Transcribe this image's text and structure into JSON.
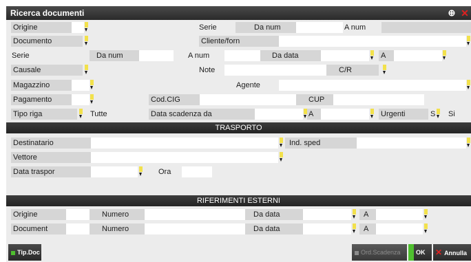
{
  "window": {
    "title": "Ricerca documenti"
  },
  "titlebar": {
    "expand_icon": "expand-icon",
    "close_icon": "close-icon",
    "close_glyph": "✕",
    "expand_glyph": "⊕"
  },
  "form": {
    "origine": "Origine",
    "serie_1": "Serie",
    "da_num_1": "Da num",
    "a_num_1": "A num",
    "documento": "Documento",
    "cliente_forn": "Cliente/forn",
    "serie_2": "Serie",
    "da_num_2": "Da num",
    "a_num_2": "A num",
    "da_data": "Da data",
    "a": "A",
    "causale": "Causale",
    "note": "Note",
    "cr": "C/R",
    "magazzino": "Magazzino",
    "agente": "Agente",
    "pagamento": "Pagamento",
    "cod_cig": "Cod.CIG",
    "cup": "CUP",
    "tipo_riga": "Tipo riga",
    "tipo_riga_value": "Tutte",
    "data_scadenza_da": "Data scadenza da",
    "a_2": "A",
    "urgenti": "Urgenti",
    "urgenti_value_code": "S",
    "urgenti_value": "Si"
  },
  "trasporto": {
    "header": "TRASPORTO",
    "destinatario": "Destinatario",
    "ind_sped": "Ind. sped",
    "vettore": "Vettore",
    "data_traspor": "Data traspor",
    "ora": "Ora"
  },
  "riferimenti": {
    "header": "RIFERIMENTI ESTERNI",
    "origine": "Origine",
    "numero_1": "Numero",
    "da_data_1": "Da data",
    "a_1": "A",
    "document": "Document",
    "numero_2": "Numero",
    "da_data_2": "Da data",
    "a_2": "A"
  },
  "buttons": {
    "tip_doc": "Tip.Doc",
    "ord_scadenza": "Ord.Scadenza",
    "ok": "OK",
    "annulla": "Annulla"
  },
  "colors": {
    "accent_green": "#4fbf2f",
    "close_red": "#e02020",
    "dropdown_yellow": "#f2e14c",
    "disabled_grey": "#8c8c8c"
  }
}
